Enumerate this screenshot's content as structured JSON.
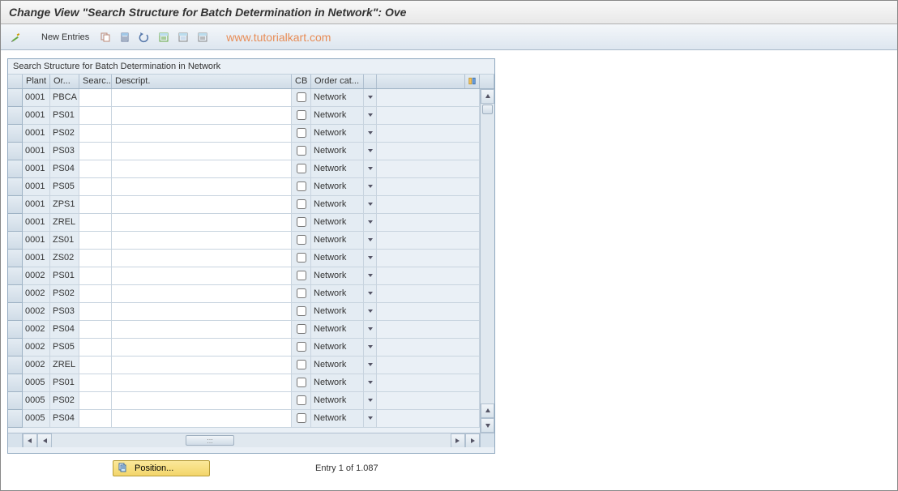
{
  "title": "Change View \"Search Structure for Batch Determination in Network\": Ove",
  "toolbar": {
    "new_entries": "New Entries"
  },
  "watermark": "www.tutorialkart.com",
  "frame": {
    "title": "Search Structure for Batch Determination in Network",
    "columns": {
      "plant": "Plant",
      "or": "Or...",
      "searc": "Searc...",
      "desc": "Descript.",
      "cb": "CB",
      "order": "Order cat..."
    }
  },
  "order_display": "Network",
  "rows": [
    {
      "plant": "0001",
      "or": "PBCA",
      "searc": "",
      "desc": "",
      "cb": false
    },
    {
      "plant": "0001",
      "or": "PS01",
      "searc": "",
      "desc": "",
      "cb": false
    },
    {
      "plant": "0001",
      "or": "PS02",
      "searc": "",
      "desc": "",
      "cb": false
    },
    {
      "plant": "0001",
      "or": "PS03",
      "searc": "",
      "desc": "",
      "cb": false
    },
    {
      "plant": "0001",
      "or": "PS04",
      "searc": "",
      "desc": "",
      "cb": false
    },
    {
      "plant": "0001",
      "or": "PS05",
      "searc": "",
      "desc": "",
      "cb": false
    },
    {
      "plant": "0001",
      "or": "ZPS1",
      "searc": "",
      "desc": "",
      "cb": false
    },
    {
      "plant": "0001",
      "or": "ZREL",
      "searc": "",
      "desc": "",
      "cb": false
    },
    {
      "plant": "0001",
      "or": "ZS01",
      "searc": "",
      "desc": "",
      "cb": false
    },
    {
      "plant": "0001",
      "or": "ZS02",
      "searc": "",
      "desc": "",
      "cb": false
    },
    {
      "plant": "0002",
      "or": "PS01",
      "searc": "",
      "desc": "",
      "cb": false
    },
    {
      "plant": "0002",
      "or": "PS02",
      "searc": "",
      "desc": "",
      "cb": false
    },
    {
      "plant": "0002",
      "or": "PS03",
      "searc": "",
      "desc": "",
      "cb": false
    },
    {
      "plant": "0002",
      "or": "PS04",
      "searc": "",
      "desc": "",
      "cb": false
    },
    {
      "plant": "0002",
      "or": "PS05",
      "searc": "",
      "desc": "",
      "cb": false
    },
    {
      "plant": "0002",
      "or": "ZREL",
      "searc": "",
      "desc": "",
      "cb": false
    },
    {
      "plant": "0005",
      "or": "PS01",
      "searc": "",
      "desc": "",
      "cb": false
    },
    {
      "plant": "0005",
      "or": "PS02",
      "searc": "",
      "desc": "",
      "cb": false
    },
    {
      "plant": "0005",
      "or": "PS04",
      "searc": "",
      "desc": "",
      "cb": false
    }
  ],
  "footer": {
    "position_label": "Position...",
    "entry_info": "Entry 1 of 1.087"
  }
}
